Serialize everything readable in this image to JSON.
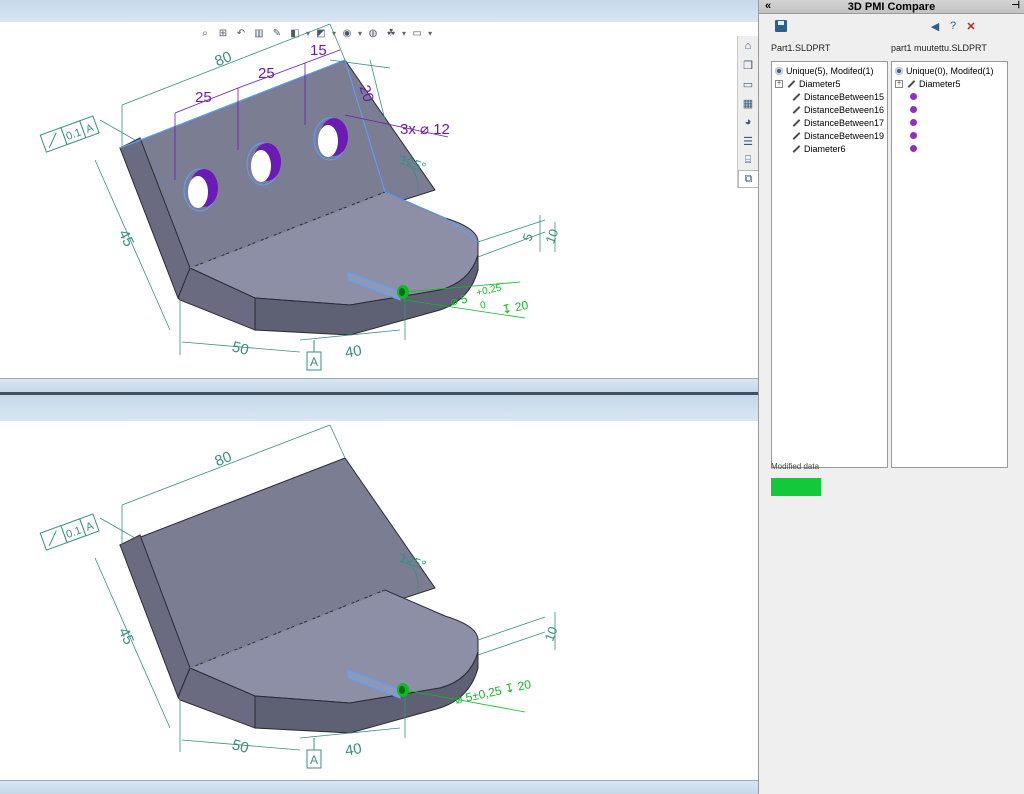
{
  "panel": {
    "title": "3D PMI Compare",
    "collapse_glyph": "«",
    "pin_glyph": "⊣",
    "file_left": "Part1.SLDPRT",
    "file_right": "part1 muutettu.SLDPRT",
    "tree_left": {
      "root": "Unique(5), Modifed(1)",
      "items": [
        "Diameter5",
        "DistanceBetween15",
        "DistanceBetween16",
        "DistanceBetween17",
        "DistanceBetween19",
        "Diameter6"
      ]
    },
    "tree_right": {
      "root": "Unique(0), Modifed(1)",
      "items": [
        "Diameter5"
      ],
      "dots": 5
    },
    "legend_label": "Modified data",
    "legend_color": "#12c93a"
  },
  "annotations_top": {
    "d80": "80",
    "d25a": "25",
    "d25b": "25",
    "d15": "15",
    "d20": "20",
    "holes": "3x ⌀ 12",
    "angle": "125°",
    "d45": "45",
    "d5": "5",
    "d10": "10",
    "d50": "50",
    "d40": "40",
    "datum": "A",
    "frame_tol": "0.1",
    "frame_datum": "A",
    "hole_dia": "⌀ 5",
    "tol_plus": "+0,25",
    "tol_minus": "0",
    "depth": "↧ 20"
  },
  "annotations_bottom": {
    "d80": "80",
    "angle": "125°",
    "d45": "45",
    "d10": "10",
    "d50": "50",
    "d40": "40",
    "datum": "A",
    "frame_tol": "0.1",
    "frame_datum": "A",
    "hole_callout": "⌀ 5±0,25 ↧ 20"
  },
  "colors": {
    "body": "#7b7d93",
    "body_top": "#8d8fa6",
    "dim": "#3a8f80",
    "purple": "#6a1bb5",
    "green": "#0dbb22"
  }
}
